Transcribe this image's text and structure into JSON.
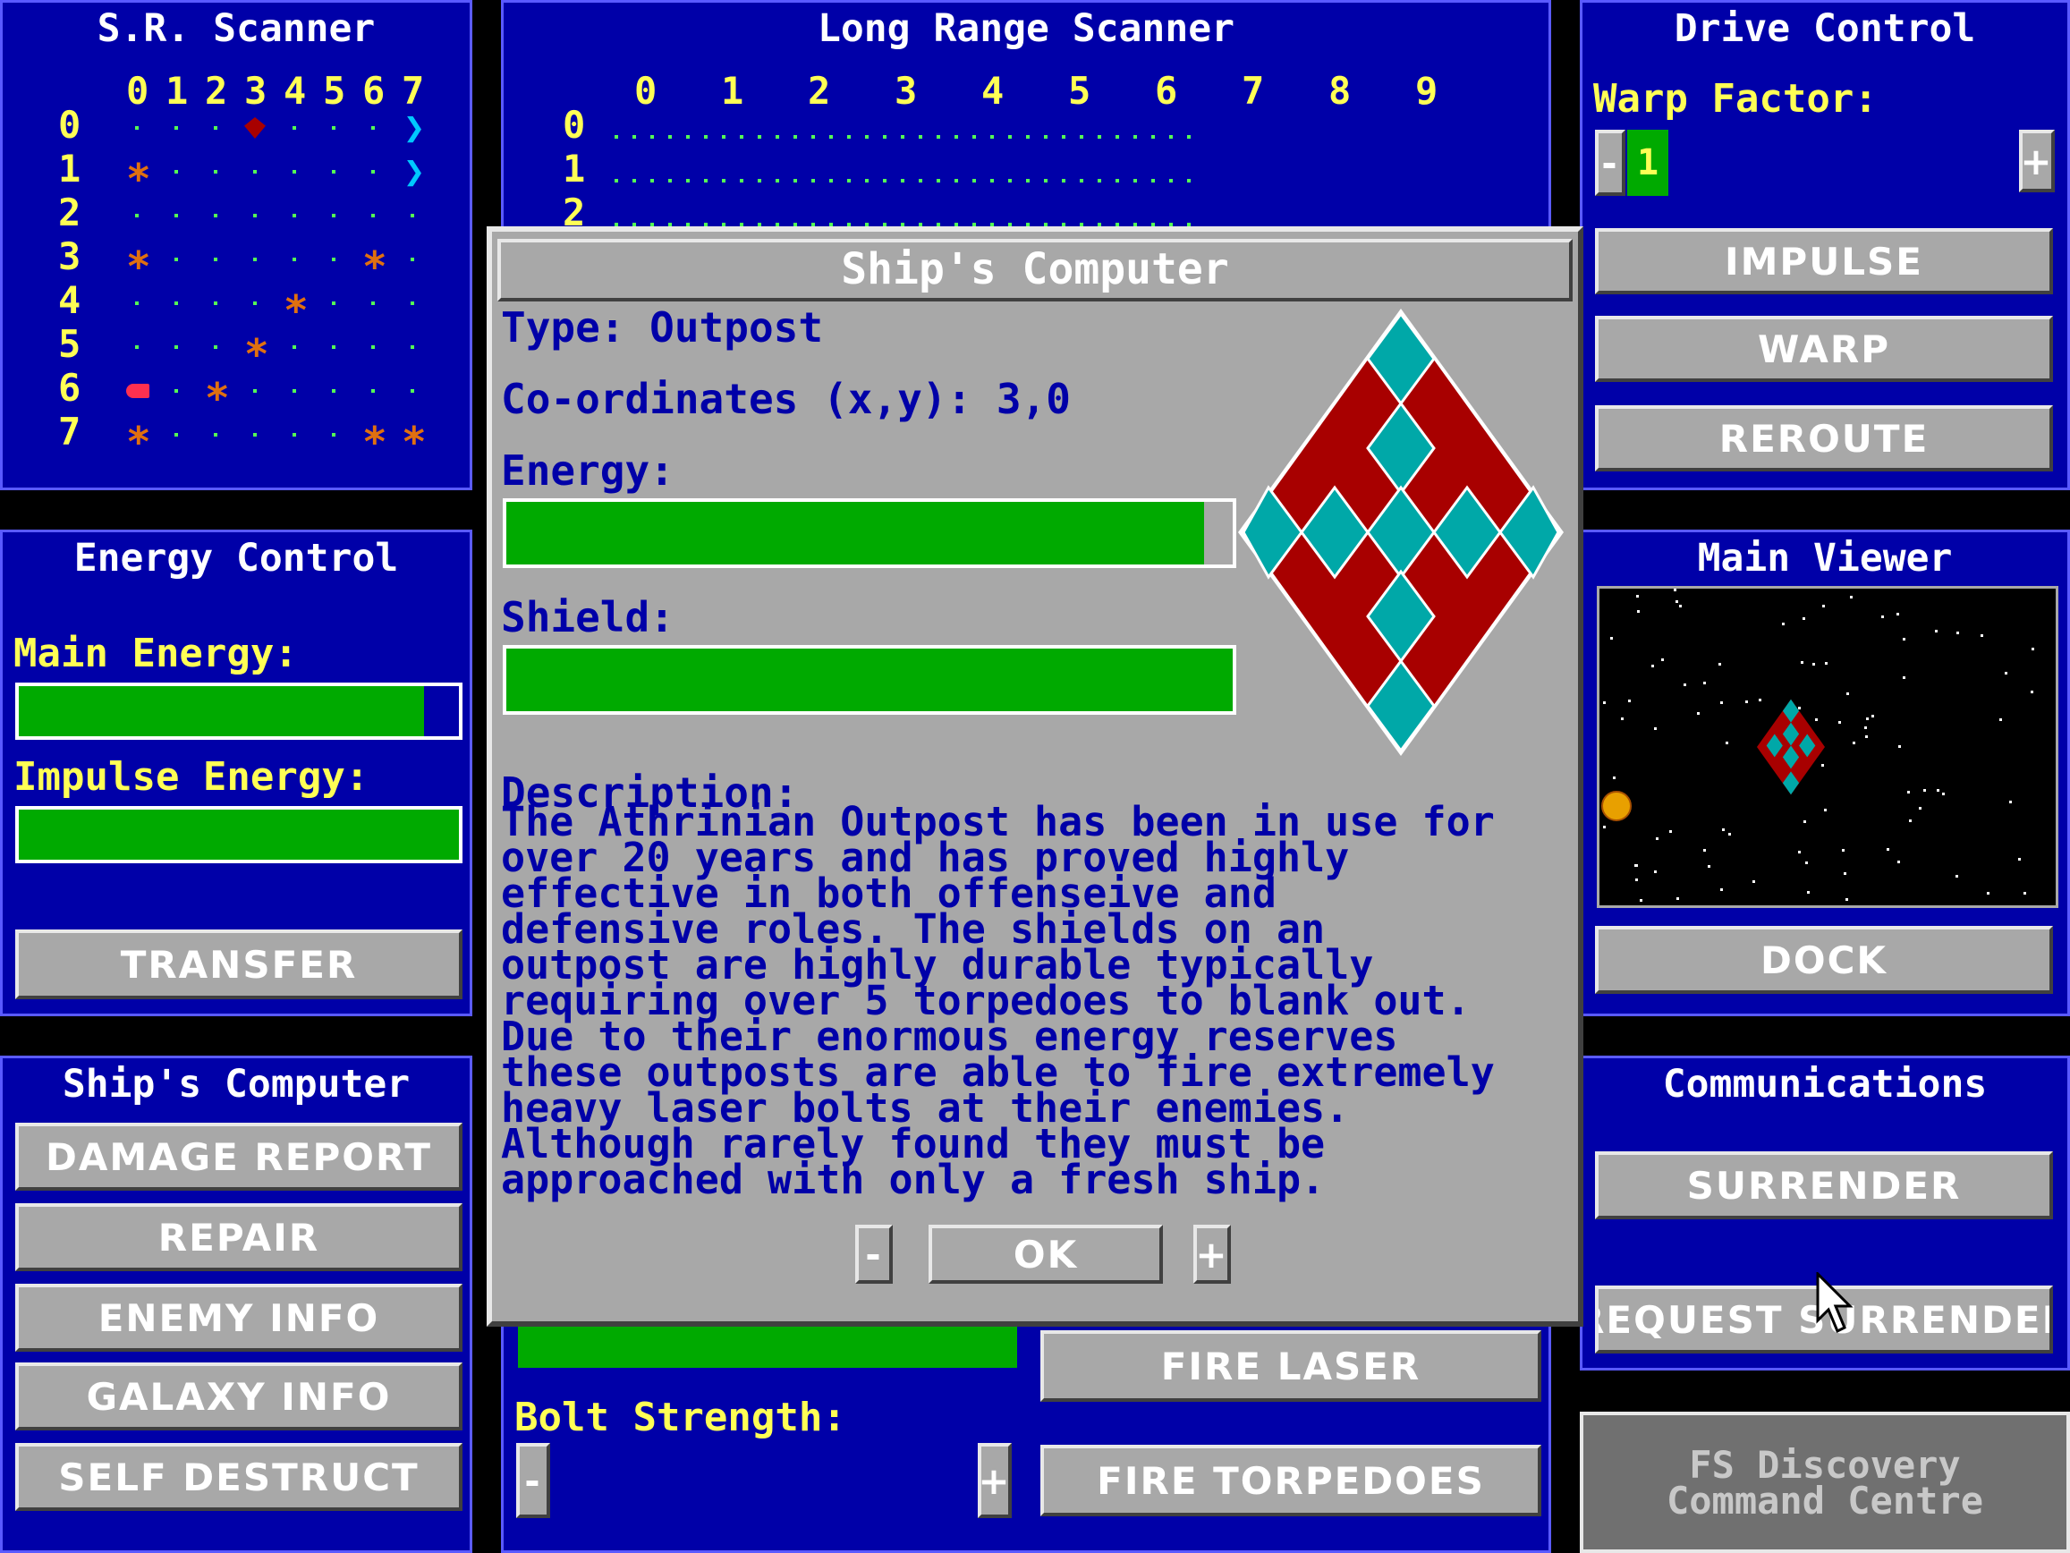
{
  "sr_scanner": {
    "title": "S.R. Scanner",
    "col_labels": [
      "0",
      "1",
      "2",
      "3",
      "4",
      "5",
      "6",
      "7"
    ],
    "row_labels": [
      "0",
      "1",
      "2",
      "3",
      "4",
      "5",
      "6",
      "7"
    ]
  },
  "lr_scanner": {
    "title": "Long Range Scanner",
    "col_labels": [
      "0",
      "1",
      "2",
      "3",
      "4",
      "5",
      "6",
      "7",
      "8",
      "9"
    ],
    "row_labels": [
      "0",
      "1",
      "2"
    ]
  },
  "drive_control": {
    "title": "Drive Control",
    "warp_label": "Warp Factor:",
    "warp_value": "1",
    "minus": "-",
    "plus": "+",
    "buttons": [
      "IMPULSE",
      "WARP",
      "REROUTE"
    ]
  },
  "energy_control": {
    "title": "Energy Control",
    "main_label": "Main Energy:",
    "main_level": 0.92,
    "impulse_label": "Impulse Energy:",
    "impulse_level": 1.0,
    "transfer": "TRANSFER"
  },
  "main_viewer": {
    "title": "Main Viewer",
    "dock": "DOCK"
  },
  "ships_computer_panel": {
    "title": "Ship's Computer",
    "buttons": [
      "DAMAGE REPORT",
      "REPAIR",
      "ENEMY INFO",
      "GALAXY INFO",
      "SELF DESTRUCT"
    ]
  },
  "communications": {
    "title": "Communications",
    "surrender": "SURRENDER",
    "request_surrender": "REQUEST SURRENDER"
  },
  "weapons": {
    "bolt_label": "Bolt Strength:",
    "fire_laser": "FIRE LASER",
    "fire_torpedoes": "FIRE TORPEDOES",
    "minus": "-",
    "plus": "+"
  },
  "footer": {
    "line1": "FS Discovery",
    "line2": "Command Centre"
  },
  "dialog": {
    "title": "Ship's Computer",
    "type": "Type: Outpost",
    "coords": "Co-ordinates (x,y): 3,0",
    "energy_label": "Energy:",
    "energy_level": 0.96,
    "shield_label": "Shield:",
    "shield_level": 1.0,
    "desc_label": "Description:",
    "description": "The Athrinian Outpost has been in use for\nover 20 years and has proved highly\neffective in both offenseive and\ndefensive roles. The shields on an\noutpost are highly durable typically\nrequiring over 5 torpedoes to blank out.\nDue to their enormous energy reserves\nthese outposts are able to fire extremely\nheavy laser bolts at their enemies.\nAlthough rarely found they must be\napproached with only a fresh ship.",
    "ok": "OK",
    "minus": "-",
    "plus": "+"
  },
  "colors": {
    "panel_bg": "#0000a8",
    "label_yellow": "#ffff55",
    "bar_green": "#00aa00",
    "button_gray": "#a8a8a8",
    "outpost_red": "#a80000",
    "outpost_cyan": "#00a8a8"
  }
}
